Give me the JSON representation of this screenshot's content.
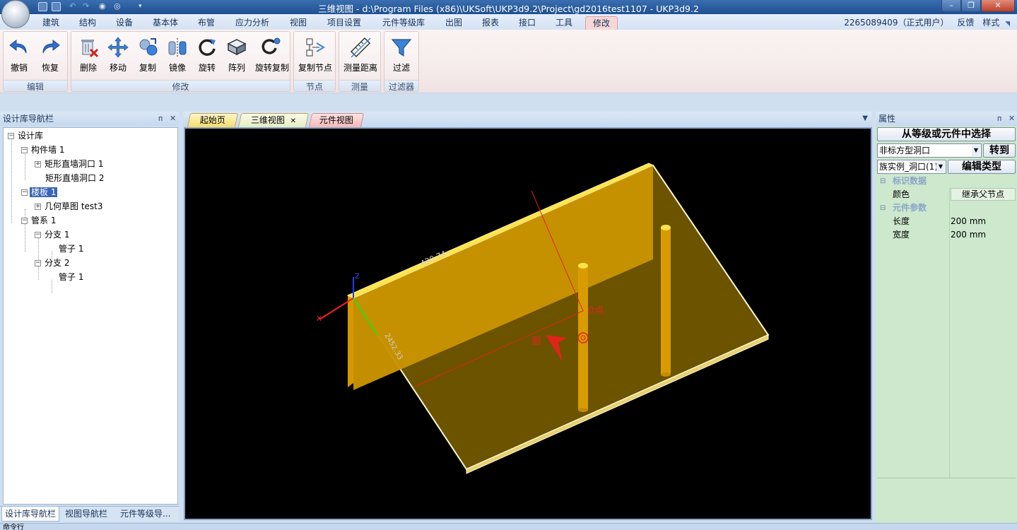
{
  "window": {
    "title": "三维视图 - d:\\Program Files (x86)\\UKSoft\\UKP3d9.2\\Project\\gd2016test1107 - UKP3d9.2",
    "minimize": "–",
    "restore": "❐",
    "close": "✕"
  },
  "ribbon": {
    "tabs": [
      "建筑",
      "结构",
      "设备",
      "基本体",
      "布管",
      "应力分析",
      "视图",
      "项目设置",
      "元件等级库",
      "出图",
      "报表",
      "接口",
      "工具",
      "修改"
    ],
    "active_tab": "修改",
    "user": "2265089409（正式用户）",
    "feedback": "反馈",
    "style": "样式",
    "groups": {
      "edit": {
        "label": "编辑",
        "undo": "撤销",
        "redo": "恢复"
      },
      "modify": {
        "label": "修改",
        "delete": "删除",
        "move": "移动",
        "copy": "复制",
        "mirror": "镜像",
        "rotate": "旋转",
        "array": "阵列",
        "rotate_copy": "旋转复制"
      },
      "node": {
        "label": "节点",
        "copy_node": "复制节点"
      },
      "measure": {
        "label": "测量",
        "measure_distance": "测量距离"
      },
      "filter": {
        "label": "过滤器",
        "filter": "过滤"
      }
    }
  },
  "left_pane": {
    "title": "设计库导航栏",
    "tree": [
      {
        "label": "设计库"
      },
      {
        "label": "构件墙 1"
      },
      {
        "label": "矩形直墙洞口 1"
      },
      {
        "label": "矩形直墙洞口 2"
      },
      {
        "label": "楼板 1"
      },
      {
        "label": "几何草图 test3"
      },
      {
        "label": "管系 1"
      },
      {
        "label": "分支 1"
      },
      {
        "label": "管子 1"
      },
      {
        "label": "分支 2"
      },
      {
        "label": "管子 1"
      }
    ],
    "bottom_tabs": [
      "设计库导航栏",
      "视图导航栏",
      "元件等级导..."
    ]
  },
  "doc_tabs": [
    "起始页",
    "三维视图",
    "元件视图"
  ],
  "active_doc_tab": "三维视图",
  "viewport": {
    "dimension_label": "420.74",
    "dimension_label2": "2452.33",
    "axis_z": "Z",
    "axis_x": "X",
    "point_label": "0点",
    "face_label": "面"
  },
  "right_pane": {
    "title": "属性",
    "select_button": "从等级或元件中选择",
    "type_combo": "非标方型洞口",
    "goto_button": "转到",
    "instance_combo": "族实例_洞口(1)",
    "edit_type_button": "编辑类型",
    "sections": [
      {
        "name": "标识数据",
        "rows": [
          {
            "name": "颜色",
            "value": "继承父节点"
          }
        ]
      },
      {
        "name": "元件参数",
        "rows": [
          {
            "name": "长度",
            "value": "200 mm"
          },
          {
            "name": "宽度",
            "value": "200 mm"
          }
        ]
      }
    ]
  },
  "status": {
    "text": "命令行"
  },
  "colors": {
    "title_bar": "#2a5c9e",
    "active_tab": "#f6d7d7",
    "wall": "#e6a800",
    "slab": "#6b5300",
    "props_bg": "#cde8cd"
  }
}
